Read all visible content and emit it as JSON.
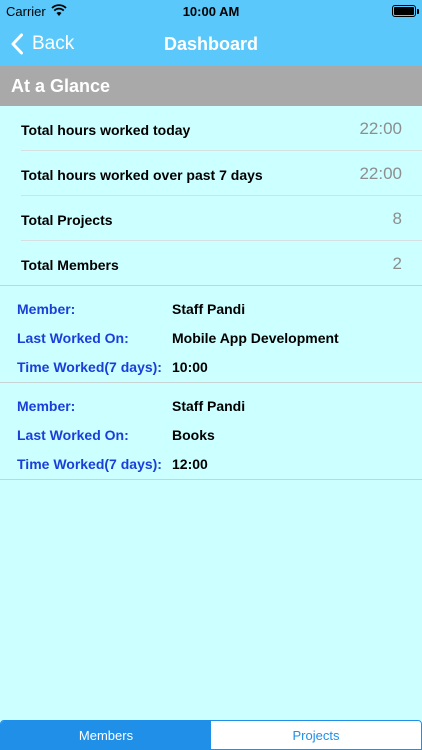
{
  "status_bar": {
    "carrier": "Carrier",
    "time": "10:00 AM",
    "wifi_icon": "wifi-icon",
    "battery_icon": "battery-icon"
  },
  "nav": {
    "back_label": "Back",
    "title": "Dashboard",
    "color": "#5ac8fa"
  },
  "section": {
    "title": "At a Glance"
  },
  "glance": [
    {
      "label": "Total hours worked today",
      "value": "22:00"
    },
    {
      "label": "Total hours worked over past 7 days",
      "value": "22:00"
    },
    {
      "label": "Total Projects",
      "value": "8"
    },
    {
      "label": "Total Members",
      "value": "2"
    }
  ],
  "members": [
    {
      "member_label": "Member:",
      "member": "Staff Pandi",
      "last_label": "Last Worked On:",
      "last": "Mobile App Development",
      "time_label": "Time Worked(7 days):",
      "time": "10:00"
    },
    {
      "member_label": "Member:",
      "member": "Staff Pandi",
      "last_label": "Last Worked On:",
      "last": "Books",
      "time_label": "Time Worked(7 days):",
      "time": "12:00"
    }
  ],
  "tabs": [
    {
      "label": "Members",
      "selected": true
    },
    {
      "label": "Projects",
      "selected": false
    }
  ]
}
